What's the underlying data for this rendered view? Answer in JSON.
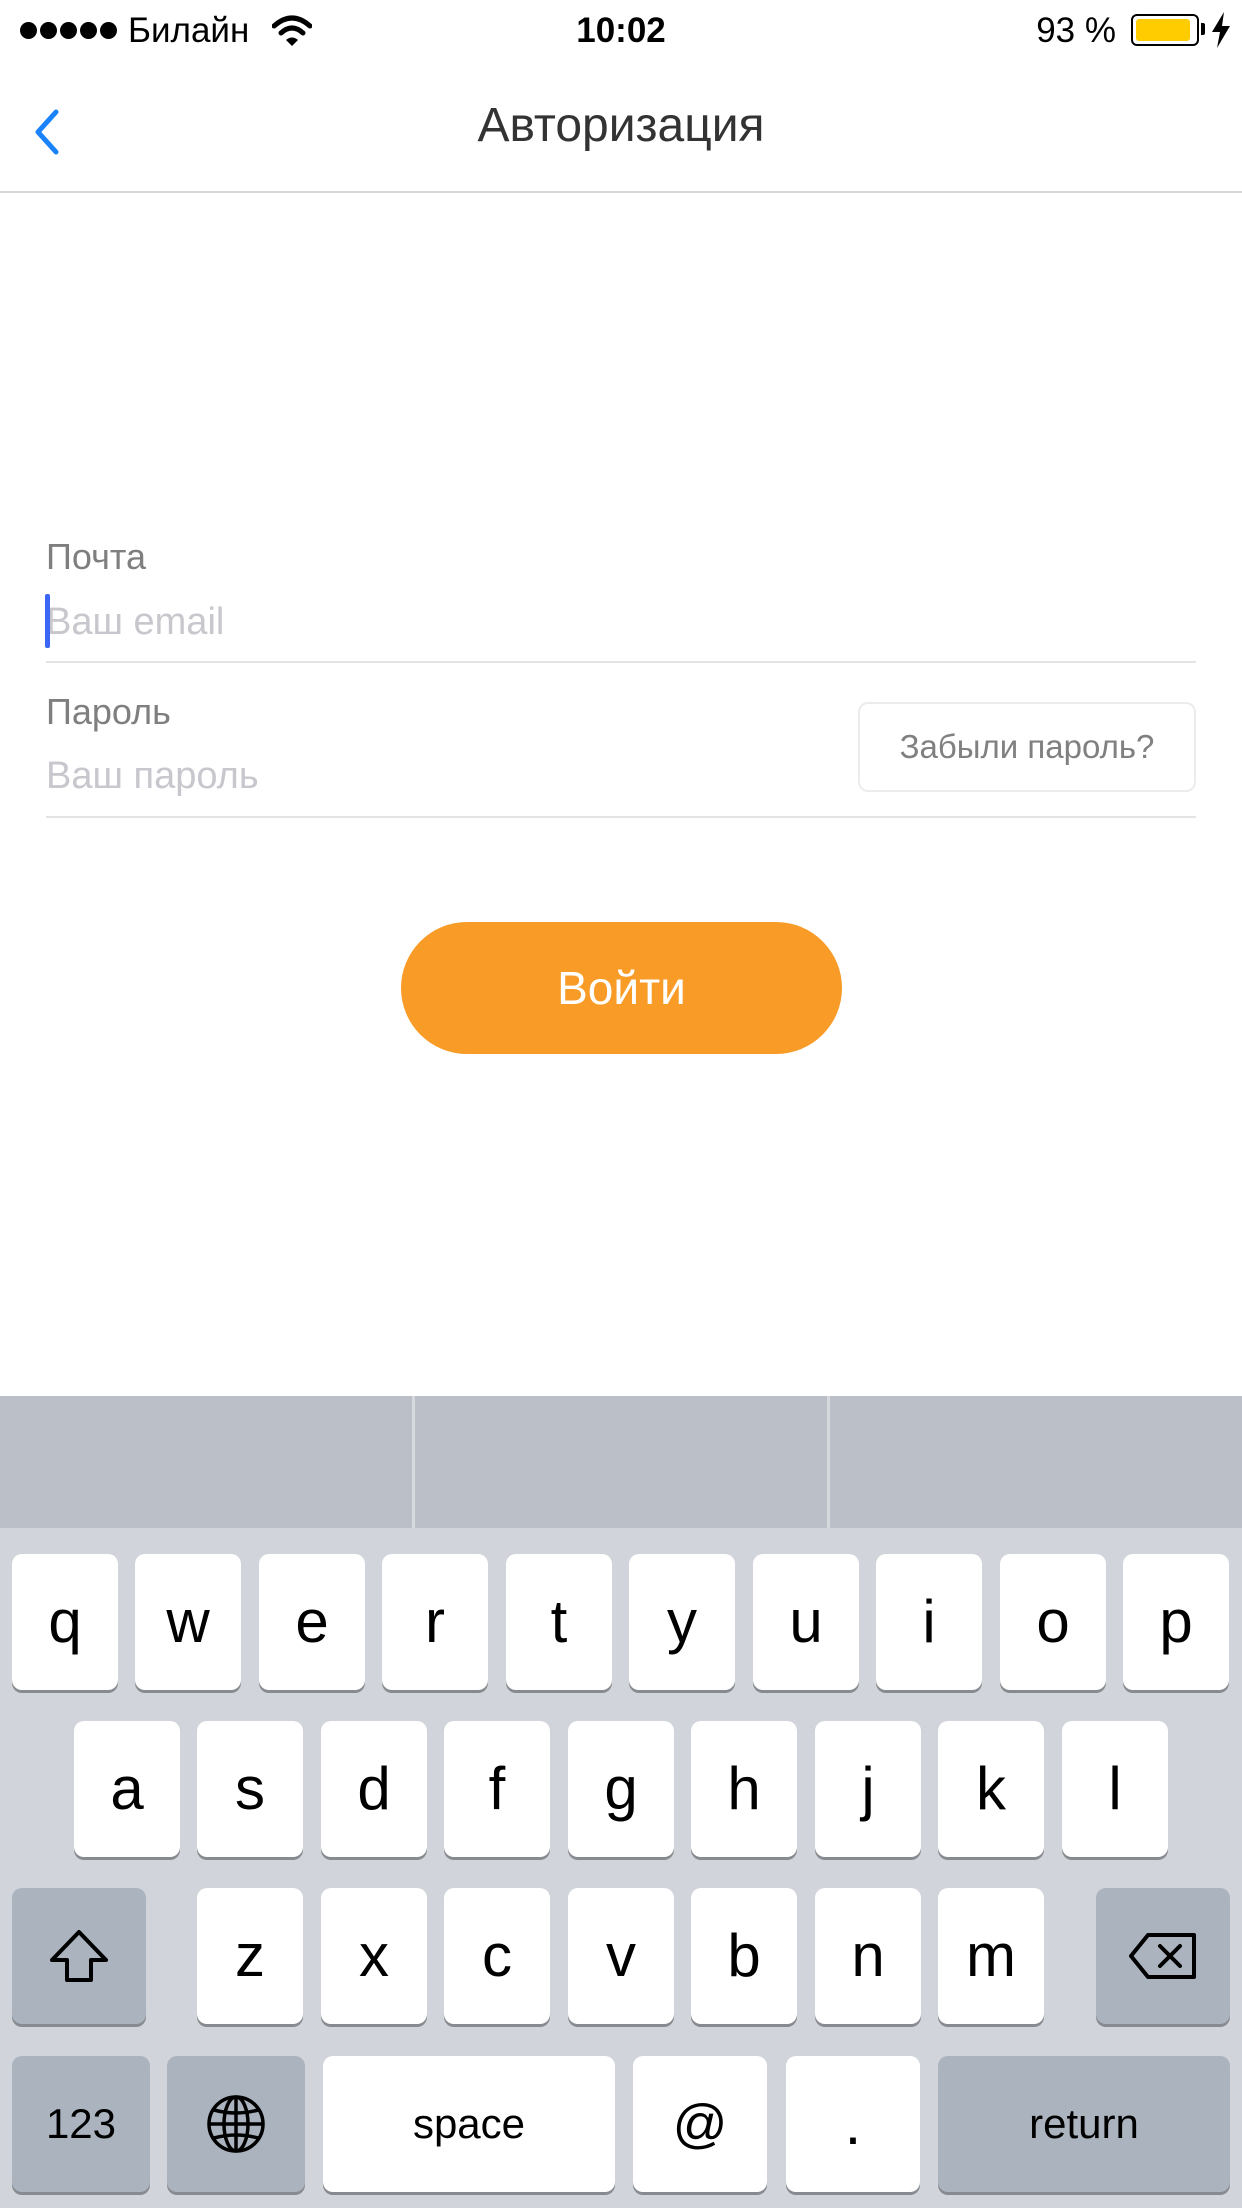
{
  "status_bar": {
    "carrier": "Билайн",
    "time": "10:02",
    "battery_percent_text": "93 %",
    "battery_level": 0.93,
    "battery_color": "#ffcc00"
  },
  "nav": {
    "title": "Авторизация",
    "back_icon": "chevron-left-icon",
    "accent_color": "#1a82fb"
  },
  "form": {
    "email": {
      "label": "Почта",
      "placeholder": "Ваш email",
      "value": ""
    },
    "password": {
      "label": "Пароль",
      "placeholder": "Ваш пароль",
      "value": ""
    },
    "forgot_label": "Забыли пароль?",
    "submit_label": "Войти",
    "submit_color": "#f99b27"
  },
  "keyboard": {
    "row1": [
      "q",
      "w",
      "e",
      "r",
      "t",
      "y",
      "u",
      "i",
      "o",
      "p"
    ],
    "row2": [
      "a",
      "s",
      "d",
      "f",
      "g",
      "h",
      "j",
      "k",
      "l"
    ],
    "row3": [
      "z",
      "x",
      "c",
      "v",
      "b",
      "n",
      "m"
    ],
    "numbers_label": "123",
    "space_label": "space",
    "at_label": "@",
    "dot_label": ".",
    "return_label": "return",
    "shift_icon": "shift-icon",
    "delete_icon": "delete-icon",
    "globe_icon": "globe-icon"
  }
}
